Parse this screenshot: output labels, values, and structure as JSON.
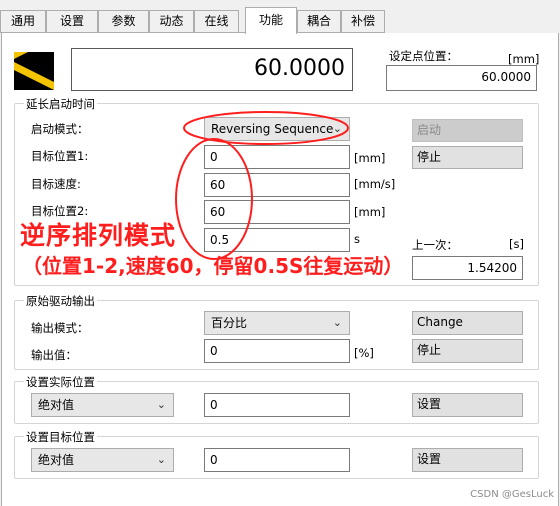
{
  "tabs": [
    "通用",
    "设置",
    "参数",
    "动态",
    "在线",
    "功能",
    "耦合",
    "补偿"
  ],
  "current_value": "60.0000",
  "setpoint": {
    "label": "设定点位置：",
    "unit": "[mm]",
    "value": "60.0000"
  },
  "delayed_start": {
    "title": "延长启动时间",
    "mode_label": "启动模式：",
    "mode_value": "Reversing Sequence",
    "start_button": "启动",
    "stop_button": "停止",
    "target_pos1_label": "目标位置1:",
    "target_pos1_value": "0",
    "target_pos1_unit": "[mm]",
    "target_speed_label": "目标速度:",
    "target_speed_value": "60",
    "target_speed_unit": "[mm/s]",
    "target_pos2_label": "目标位置2:",
    "target_pos2_value": "60",
    "target_pos2_unit": "[mm]",
    "dwell_value": "0.5",
    "dwell_unit": "s",
    "last_label": "上一次：",
    "last_unit": "[s]",
    "last_value": "1.54200"
  },
  "annotation": {
    "title": "逆序排列模式",
    "subtitle": "（位置1-2,速度60，停留0.5S往复运动）",
    "color": "#ff1e1e"
  },
  "raw_drive": {
    "title": "原始驱动输出",
    "mode_label": "输出模式：",
    "mode_value": "百分比",
    "change_button": "Change",
    "value_label": "输出值：",
    "value": "0",
    "unit": "[%]",
    "stop_button": "停止"
  },
  "actual_position": {
    "title": "设置实际位置",
    "mode_value": "绝对值",
    "value": "0",
    "button": "设置"
  },
  "target_position": {
    "title": "设置目标位置",
    "mode_value": "绝对值",
    "value": "0",
    "button": "设置"
  },
  "watermark": "CSDN @GesLuck"
}
